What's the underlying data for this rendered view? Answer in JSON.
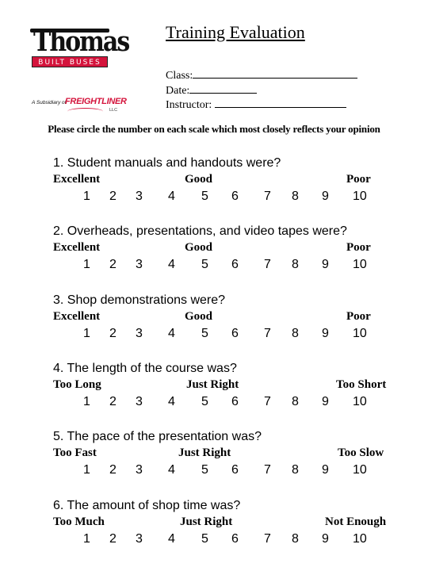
{
  "logo": {
    "brand": "Thomas",
    "tagline": "BUILT BUSES",
    "subsidiary_prefix": "A Subsidiary of",
    "subsidiary_brand": "FREIGHTLINER",
    "subsidiary_suffix": "LLC",
    "colors": {
      "red": "#d4143c",
      "black": "#111111"
    }
  },
  "header": {
    "title": "Training Evaluation",
    "fields": [
      {
        "label": "Class:",
        "value": ""
      },
      {
        "label": "Date:",
        "value": ""
      },
      {
        "label": "Instructor:",
        "value": ""
      }
    ]
  },
  "instructions": "Please circle the number on each scale which most closely reflects your opinion",
  "scale": [
    "1",
    "2",
    "3",
    "4",
    "5",
    "6",
    "7",
    "8",
    "9",
    "10"
  ],
  "questions": [
    {
      "text": "1.  Student manuals and handouts were?",
      "low": "Excellent",
      "mid": "Good",
      "high": "Poor"
    },
    {
      "text": "2.  Overheads, presentations, and video tapes were?",
      "low": "Excellent",
      "mid": "Good",
      "high": "Poor"
    },
    {
      "text": "3.  Shop demonstrations were?",
      "low": "Excellent",
      "mid": "Good",
      "high": "Poor"
    },
    {
      "text": "4.  The length of the course was?",
      "low": "Too Long",
      "mid": "Just Right",
      "high": "Too Short"
    },
    {
      "text": "5.  The pace of the presentation was?",
      "low": "Too Fast",
      "mid": "Just Right",
      "high": "Too Slow"
    },
    {
      "text": "6.  The amount of shop time was?",
      "low": "Too Much",
      "mid": "Just Right",
      "high": "Not Enough"
    }
  ]
}
